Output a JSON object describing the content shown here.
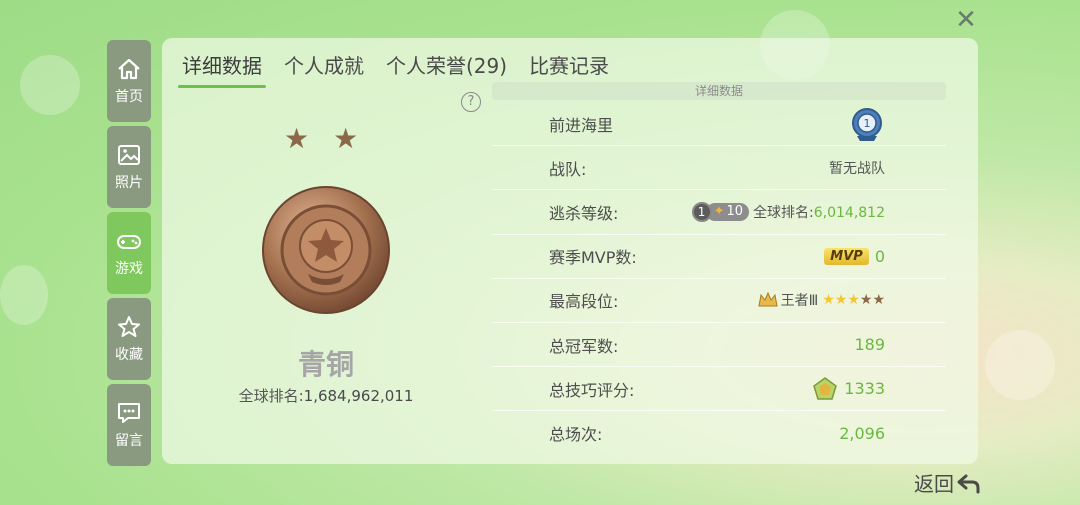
{
  "sidebar": {
    "items": [
      {
        "label": "首页",
        "icon": "home-icon"
      },
      {
        "label": "照片",
        "icon": "photo-icon"
      },
      {
        "label": "游戏",
        "icon": "gamepad-icon"
      },
      {
        "label": "收藏",
        "icon": "star-box-icon"
      },
      {
        "label": "留言",
        "icon": "message-icon"
      }
    ],
    "active_index": 2
  },
  "tabs": [
    {
      "label": "详细数据"
    },
    {
      "label": "个人成就"
    },
    {
      "label": "个人荣誉(29)"
    },
    {
      "label": "比赛记录"
    }
  ],
  "left": {
    "help_symbol": "?",
    "rank_name": "青铜",
    "global_rank_label": "全球排名:",
    "global_rank_value": "1,684,962,011"
  },
  "detail": {
    "header": "详细数据",
    "rows": [
      {
        "label": "前进海里"
      },
      {
        "label": "战队:",
        "value": "暂无战队"
      },
      {
        "label": "逃杀等级:",
        "level_left": "1",
        "level_right": "10",
        "rank_label": "全球排名:",
        "rank_value": "6,014,812"
      },
      {
        "label": "赛季MVP数:",
        "badge": "MVP",
        "value": "0"
      },
      {
        "label": "最高段位:",
        "value": "王者Ⅲ"
      },
      {
        "label": "总冠军数:",
        "value": "189"
      },
      {
        "label": "总技巧评分:",
        "value": "1333"
      },
      {
        "label": "总场次:",
        "value": "2,096"
      }
    ]
  },
  "back_label": "返回",
  "colors": {
    "accent_green": "#6ab842",
    "active_tab_underline": "#6fbf4b",
    "bronze": "#a4714f"
  }
}
